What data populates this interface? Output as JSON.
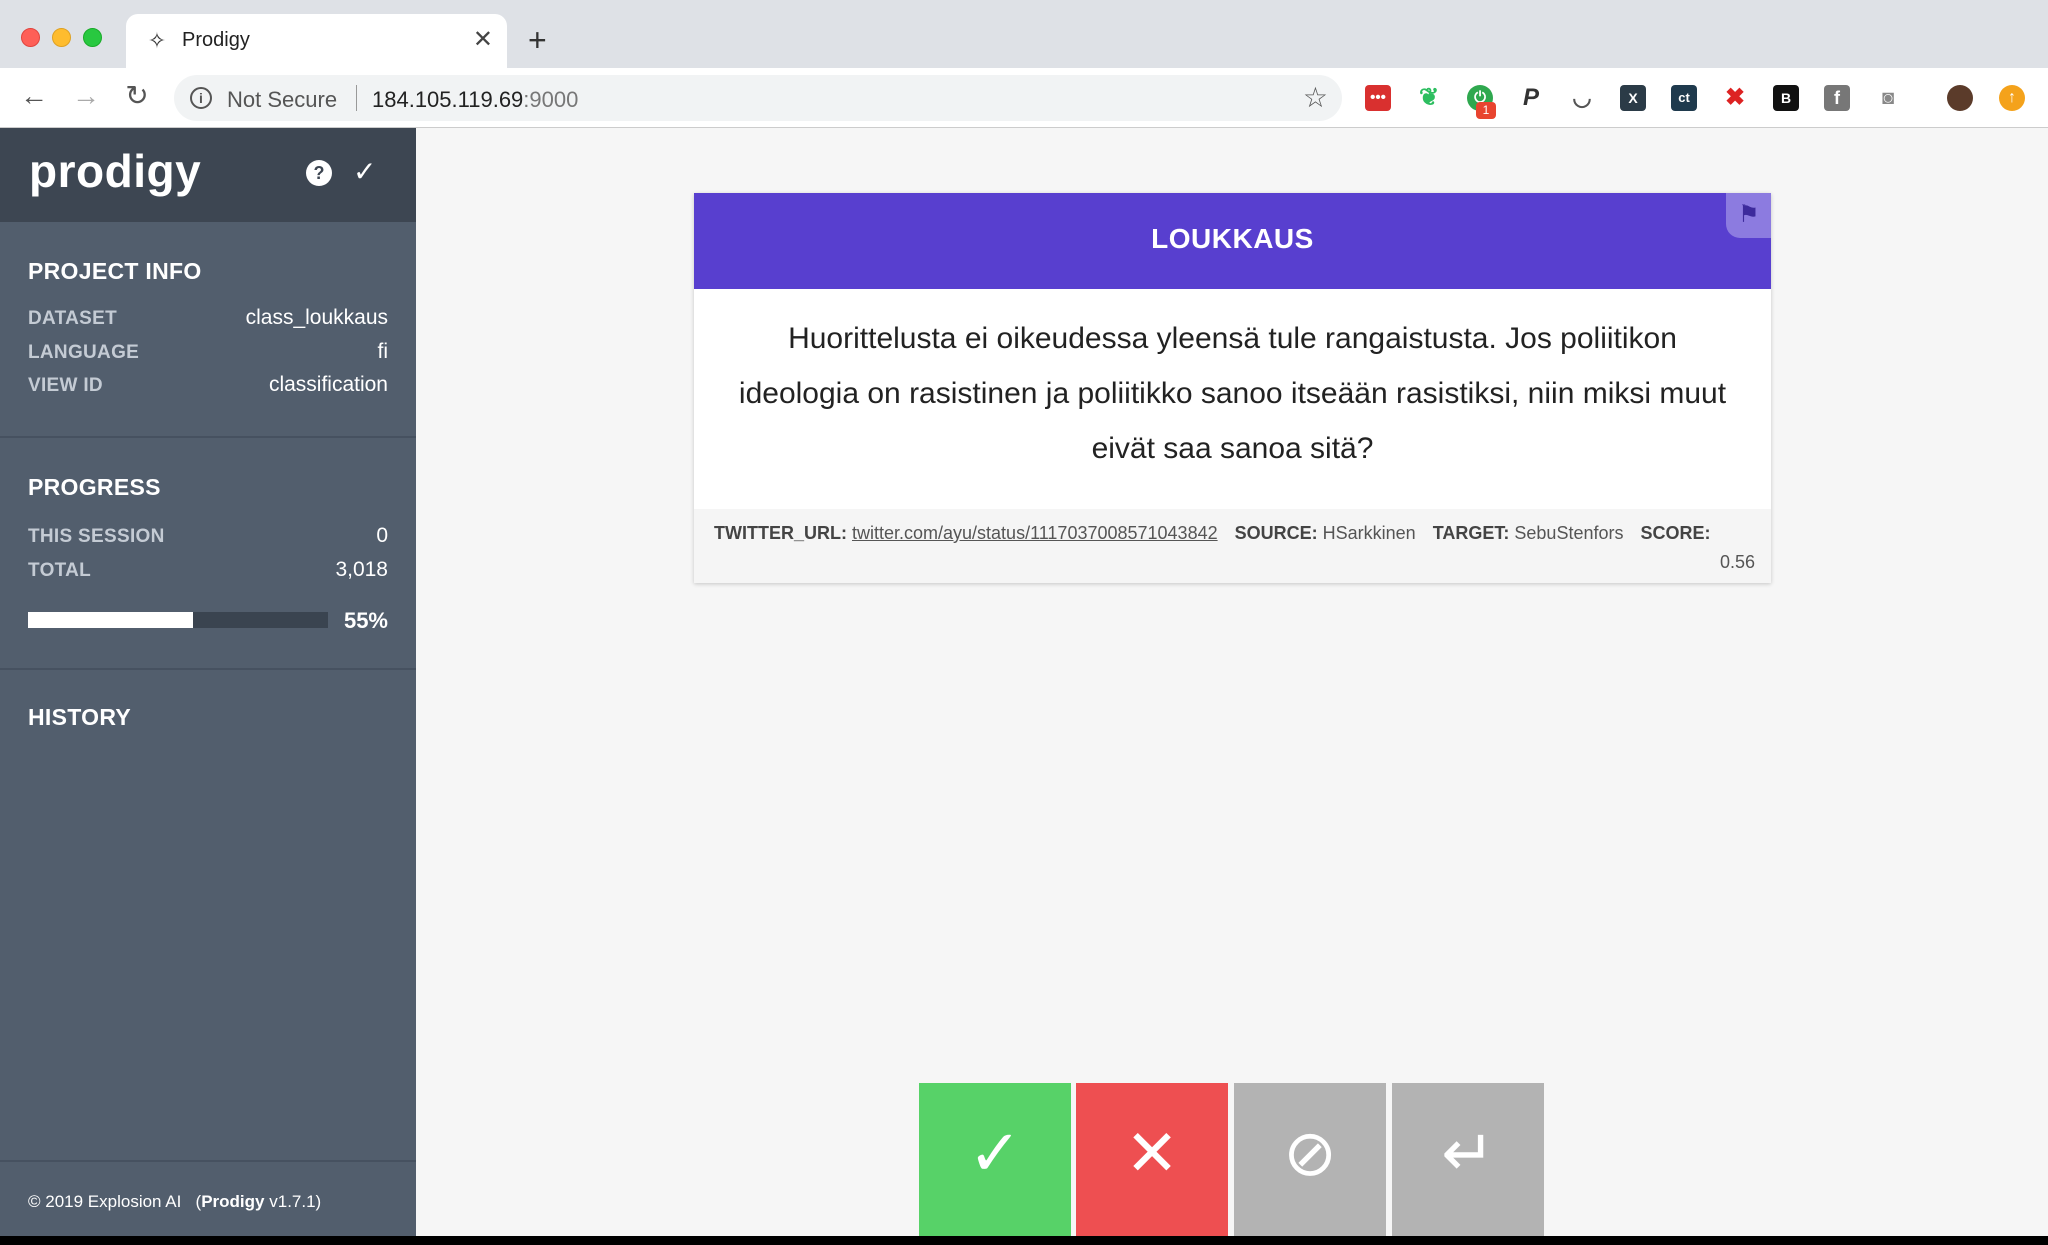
{
  "browser": {
    "tab_title": "Prodigy",
    "tab_icon": "sparkle-icon",
    "security_label": "Not Secure",
    "url_host": "184.105.119.69",
    "url_port": ":9000",
    "extension_badge": "1"
  },
  "sidebar": {
    "logo": "prodigy",
    "project_info": {
      "title": "PROJECT INFO",
      "rows": [
        {
          "label": "DATASET",
          "value": "class_loukkaus"
        },
        {
          "label": "LANGUAGE",
          "value": "fi"
        },
        {
          "label": "VIEW ID",
          "value": "classification"
        }
      ]
    },
    "progress": {
      "title": "PROGRESS",
      "rows": [
        {
          "label": "THIS SESSION",
          "value": "0"
        },
        {
          "label": "TOTAL",
          "value": "3,018"
        }
      ],
      "fraction": 0.55,
      "percent_label": "55%"
    },
    "history": {
      "title": "HISTORY"
    },
    "footer": {
      "copyright": "© 2019 Explosion AI",
      "product": "Prodigy",
      "version": "v1.7.1"
    }
  },
  "card": {
    "label": "LOUKKAUS",
    "text": "Huorittelusta ei oikeudessa yleensä tule rangaistusta. Jos poliitikon ideologia on rasistinen ja poliitikko sanoo itseään rasistiksi, niin miksi muut eivät saa sanoa sitä?",
    "meta": {
      "twitter_url_label": "TWITTER_URL:",
      "twitter_url": "twitter.com/ayu/status/1117037008571043842",
      "source_label": "SOURCE:",
      "source": "HSarkkinen",
      "target_label": "TARGET:",
      "target": "SebuStenfors",
      "score_label": "SCORE:",
      "score": "0.56"
    }
  },
  "actions": {
    "accept": "✓",
    "reject": "✕",
    "ignore": "⊘",
    "undo": "↵"
  },
  "colors": {
    "accent": "#583fcf",
    "sidebar": "#525e6d",
    "accept": "#57d268",
    "reject": "#ee4f51",
    "neutral": "#b3b3b3"
  }
}
